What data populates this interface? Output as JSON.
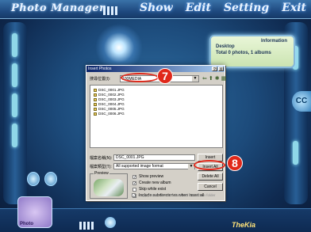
{
  "app": {
    "title": "Photo Manager",
    "menu": [
      "Show",
      "Edit",
      "Setting",
      "Exit"
    ],
    "brand": "TheKia"
  },
  "info_panel": {
    "header": "Information",
    "line1": "Desktop",
    "line2": "Total 0 photos, 1 albums"
  },
  "dialog": {
    "title": "Insert Photos",
    "controls": [
      "?",
      "X"
    ],
    "lookin_label": "搜尋位置(I):",
    "lookin_value": "100MEDIA",
    "files": [
      "DSC_0001.JPG",
      "DSC_0002.JPG",
      "DSC_0003.JPG",
      "DSC_0004.JPG",
      "DSC_0005.JPG",
      "DSC_0006.JPG"
    ],
    "filename_label": "檔案名稱(N):",
    "filename_value": "DSC_0001.JPG",
    "filetype_label": "檔案類型(T):",
    "filetype_value": "All supported image format",
    "buttons": {
      "insert": "Insert",
      "insert_all": "Insert All",
      "delete_all": "Delete All",
      "cancel": "Cancel"
    },
    "preview_label": "Preview",
    "options": [
      {
        "label": "Show preview",
        "checked": true,
        "disabled": false
      },
      {
        "label": "Create new album",
        "checked": true,
        "disabled": false
      },
      {
        "label": "Skip while exist",
        "checked": false,
        "disabled": false
      },
      {
        "label": "Include subdirectories when insert all",
        "checked": false,
        "disabled": false
      },
      {
        "label": "Copy photos who were inserted into album folder",
        "checked": true,
        "disabled": true
      }
    ]
  },
  "callouts": {
    "step7": "7",
    "step8": "8"
  },
  "side_icon": "CC"
}
